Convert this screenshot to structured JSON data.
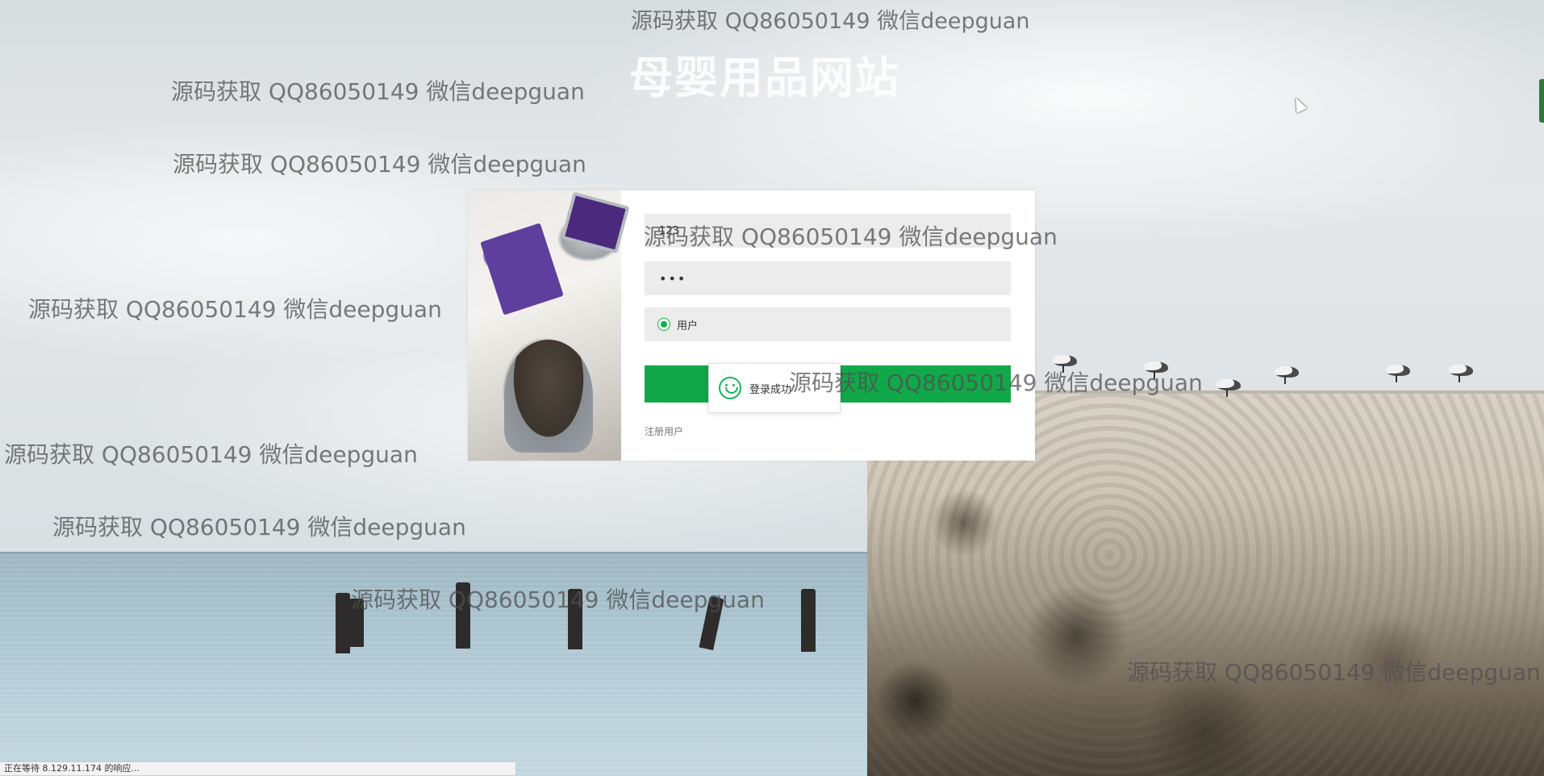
{
  "site": {
    "title": "母婴用品网站"
  },
  "watermark": {
    "text": "源码获取 QQ86050149 微信deepguan"
  },
  "login": {
    "username_value": "123",
    "password_value": "•••",
    "role_label": "用户",
    "login_button_label": "",
    "register_link": "注册用户"
  },
  "toast": {
    "message": "登录成功"
  },
  "status_bar": {
    "text": "正在等待 8.129.11.174 的响应..."
  },
  "colors": {
    "accent": "#11a84a",
    "field_bg": "#ececec"
  }
}
